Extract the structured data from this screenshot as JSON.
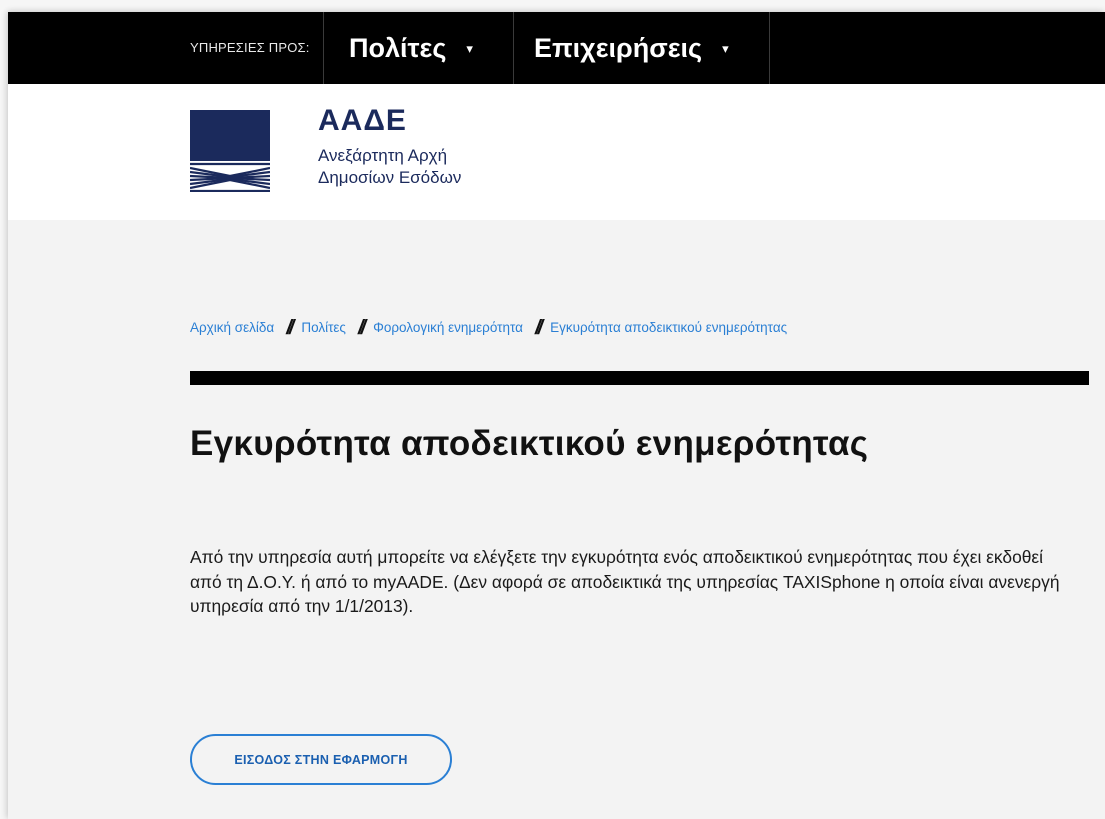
{
  "topnav": {
    "services_label": "ΥΠΗΡΕΣΙΕΣ ΠΡΟΣ:",
    "items": [
      {
        "label": "Πολίτες",
        "caret": "▾"
      },
      {
        "label": "Επιχειρήσεις",
        "caret": "▾"
      }
    ]
  },
  "logo": {
    "title": "ΑΑΔΕ",
    "subtitle_line1": "Ανεξάρτητη Αρχή",
    "subtitle_line2": "Δημοσίων Εσόδων",
    "color": "#1b2a5c"
  },
  "breadcrumb": [
    "Αρχική σελίδα",
    "Πολίτες",
    "Φορολογική ενημερότητα",
    "Εγκυρότητα αποδεικτικού ενημερότητας"
  ],
  "breadcrumb_separator": "//",
  "page": {
    "title": "Εγκυρότητα αποδεικτικού ενημερότητας",
    "description": "Από την υπηρεσία αυτή μπορείτε να ελέγξετε την εγκυρότητα ενός αποδεικτικού ενημερότητας που έχει εκδοθεί από τη Δ.Ο.Υ. ή από το myAADE. (Δεν αφορά σε αποδεικτικά της υπηρεσίας TAXISphone η οποία είναι  ανενεργή υπηρεσία από την 1/1/2013).",
    "enter_button": "ΕΙΣΟΔΟΣ ΣΤΗΝ ΕΦΑΡΜΟΓΗ"
  },
  "colors": {
    "link": "#2a7fd4",
    "nav_bg": "#000000",
    "page_bg": "#f3f3f3"
  }
}
